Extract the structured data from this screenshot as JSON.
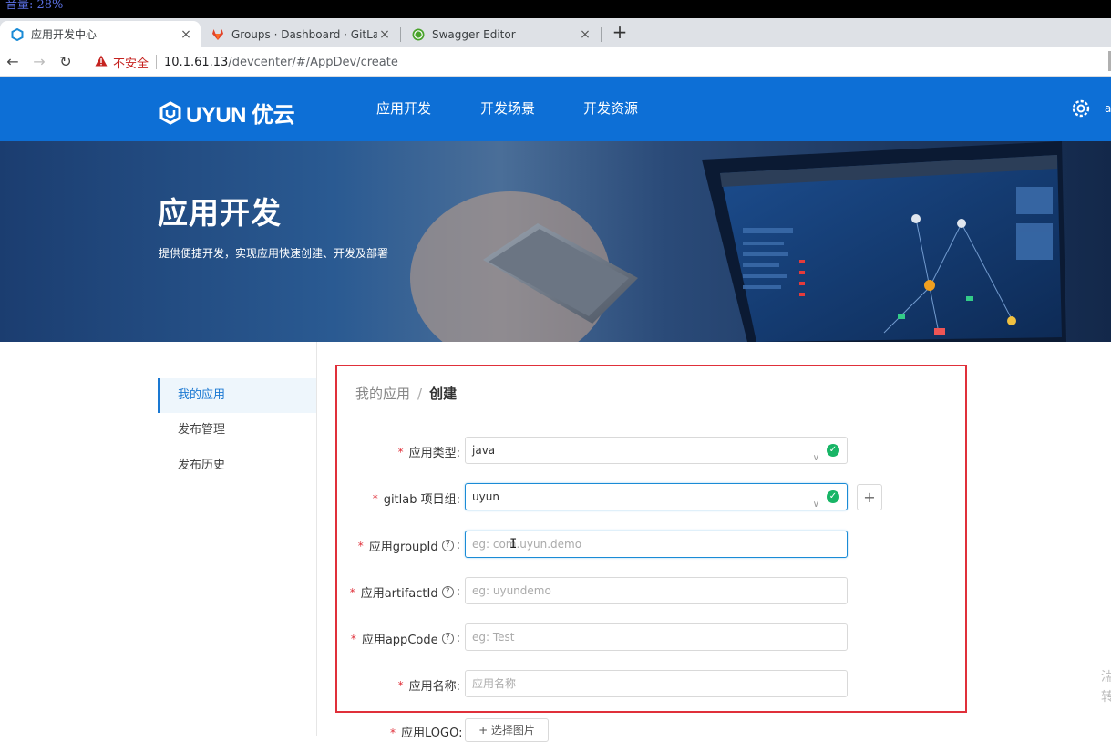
{
  "osd": {
    "text": "音量: 28%"
  },
  "browser": {
    "tabs": [
      {
        "title": "应用开发中心",
        "active": true,
        "close": "×"
      },
      {
        "title": "Groups · Dashboard · GitLab",
        "active": false,
        "close": "×"
      },
      {
        "title": "Swagger Editor",
        "active": false,
        "close": "×"
      }
    ],
    "new_tab": "+",
    "back_icon": "←",
    "forward_icon": "→",
    "reload_icon": "↻",
    "security_label": "不安全",
    "url_host": "10.1.61.13",
    "url_path": "/devcenter/#/AppDev/create"
  },
  "header": {
    "logo_text": "UYUN 优云",
    "nav": [
      "应用开发",
      "开发场景",
      "开发资源"
    ],
    "user_stub": "a"
  },
  "banner": {
    "title": "应用开发",
    "subtitle": "提供便捷开发，实现应用快速创建、开发及部署"
  },
  "sidebar": {
    "items": [
      {
        "label": "我的应用",
        "active": true
      },
      {
        "label": "发布管理",
        "active": false
      },
      {
        "label": "发布历史",
        "active": false
      }
    ]
  },
  "breadcrumb": {
    "parent": "我的应用",
    "separator": "/",
    "current": "创建"
  },
  "form": {
    "app_type": {
      "label": "应用类型:",
      "value": "java"
    },
    "gitlab_group": {
      "label": "gitlab 项目组:",
      "value": "uyun",
      "add_button": "+"
    },
    "group_id": {
      "label": "应用groupId",
      "placeholder": "eg: com.uyun.demo",
      "help": "?"
    },
    "artifact_id": {
      "label": "应用artifactId",
      "placeholder": "eg: uyundemo",
      "help": "?"
    },
    "app_code": {
      "label": "应用appCode",
      "placeholder": "eg: Test",
      "help": "?"
    },
    "app_name": {
      "label": "应用名称:",
      "placeholder": "应用名称"
    },
    "logo": {
      "label": "应用LOGO:",
      "button": "+ 选择图片"
    },
    "required_mark": "*",
    "colon": ":"
  },
  "right_stub": [
    "湍",
    "转"
  ],
  "colors": {
    "header": "#0d6fd6",
    "accent": "#1a78d2",
    "annotation": "#e0303a",
    "ok": "#18b566"
  }
}
